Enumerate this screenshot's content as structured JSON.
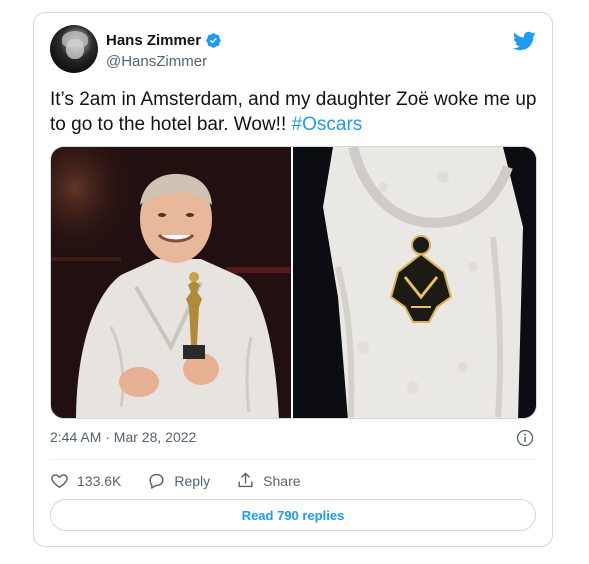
{
  "tweet": {
    "author_name": "Hans Zimmer",
    "handle": "@HansZimmer",
    "text_main": "It’s 2am in Amsterdam, and my daughter Zoë woke me up to go to the hotel bar. Wow!! ",
    "hashtag": "#Oscars",
    "timestamp": "2:44 AM · Mar 28, 2022"
  },
  "actions": {
    "likes": "133.6K",
    "reply_label": "Reply",
    "share_label": "Share"
  },
  "read_replies_label": "Read 790 replies",
  "colors": {
    "accent": "#1d9bf0",
    "text": "#0f1419",
    "secondary": "#536471",
    "border": "#cfd9de"
  },
  "icons": [
    "verified-badge-icon",
    "twitter-bird-icon",
    "info-icon",
    "heart-icon",
    "reply-icon",
    "share-icon"
  ]
}
